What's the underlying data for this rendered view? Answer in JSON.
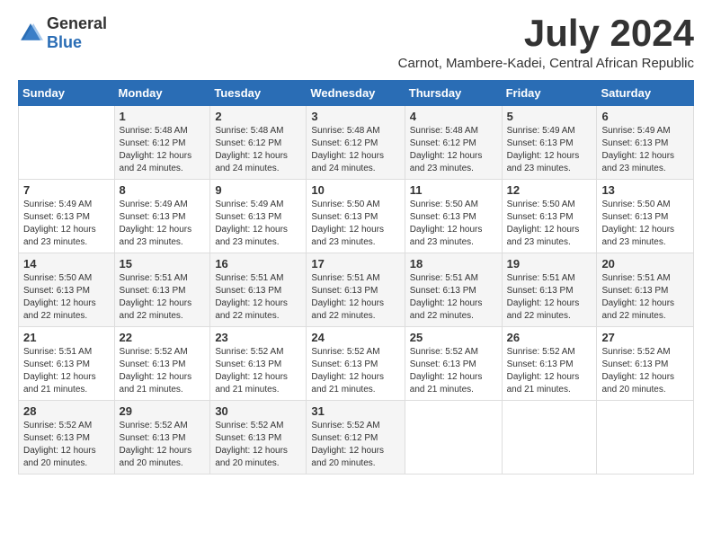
{
  "logo": {
    "general": "General",
    "blue": "Blue"
  },
  "title": "July 2024",
  "subtitle": "Carnot, Mambere-Kadei, Central African Republic",
  "days_header": [
    "Sunday",
    "Monday",
    "Tuesday",
    "Wednesday",
    "Thursday",
    "Friday",
    "Saturday"
  ],
  "weeks": [
    [
      {
        "num": "",
        "sunrise": "",
        "sunset": "",
        "daylight": ""
      },
      {
        "num": "1",
        "sunrise": "Sunrise: 5:48 AM",
        "sunset": "Sunset: 6:12 PM",
        "daylight": "Daylight: 12 hours and 24 minutes."
      },
      {
        "num": "2",
        "sunrise": "Sunrise: 5:48 AM",
        "sunset": "Sunset: 6:12 PM",
        "daylight": "Daylight: 12 hours and 24 minutes."
      },
      {
        "num": "3",
        "sunrise": "Sunrise: 5:48 AM",
        "sunset": "Sunset: 6:12 PM",
        "daylight": "Daylight: 12 hours and 24 minutes."
      },
      {
        "num": "4",
        "sunrise": "Sunrise: 5:48 AM",
        "sunset": "Sunset: 6:12 PM",
        "daylight": "Daylight: 12 hours and 23 minutes."
      },
      {
        "num": "5",
        "sunrise": "Sunrise: 5:49 AM",
        "sunset": "Sunset: 6:13 PM",
        "daylight": "Daylight: 12 hours and 23 minutes."
      },
      {
        "num": "6",
        "sunrise": "Sunrise: 5:49 AM",
        "sunset": "Sunset: 6:13 PM",
        "daylight": "Daylight: 12 hours and 23 minutes."
      }
    ],
    [
      {
        "num": "7",
        "sunrise": "Sunrise: 5:49 AM",
        "sunset": "Sunset: 6:13 PM",
        "daylight": "Daylight: 12 hours and 23 minutes."
      },
      {
        "num": "8",
        "sunrise": "Sunrise: 5:49 AM",
        "sunset": "Sunset: 6:13 PM",
        "daylight": "Daylight: 12 hours and 23 minutes."
      },
      {
        "num": "9",
        "sunrise": "Sunrise: 5:49 AM",
        "sunset": "Sunset: 6:13 PM",
        "daylight": "Daylight: 12 hours and 23 minutes."
      },
      {
        "num": "10",
        "sunrise": "Sunrise: 5:50 AM",
        "sunset": "Sunset: 6:13 PM",
        "daylight": "Daylight: 12 hours and 23 minutes."
      },
      {
        "num": "11",
        "sunrise": "Sunrise: 5:50 AM",
        "sunset": "Sunset: 6:13 PM",
        "daylight": "Daylight: 12 hours and 23 minutes."
      },
      {
        "num": "12",
        "sunrise": "Sunrise: 5:50 AM",
        "sunset": "Sunset: 6:13 PM",
        "daylight": "Daylight: 12 hours and 23 minutes."
      },
      {
        "num": "13",
        "sunrise": "Sunrise: 5:50 AM",
        "sunset": "Sunset: 6:13 PM",
        "daylight": "Daylight: 12 hours and 23 minutes."
      }
    ],
    [
      {
        "num": "14",
        "sunrise": "Sunrise: 5:50 AM",
        "sunset": "Sunset: 6:13 PM",
        "daylight": "Daylight: 12 hours and 22 minutes."
      },
      {
        "num": "15",
        "sunrise": "Sunrise: 5:51 AM",
        "sunset": "Sunset: 6:13 PM",
        "daylight": "Daylight: 12 hours and 22 minutes."
      },
      {
        "num": "16",
        "sunrise": "Sunrise: 5:51 AM",
        "sunset": "Sunset: 6:13 PM",
        "daylight": "Daylight: 12 hours and 22 minutes."
      },
      {
        "num": "17",
        "sunrise": "Sunrise: 5:51 AM",
        "sunset": "Sunset: 6:13 PM",
        "daylight": "Daylight: 12 hours and 22 minutes."
      },
      {
        "num": "18",
        "sunrise": "Sunrise: 5:51 AM",
        "sunset": "Sunset: 6:13 PM",
        "daylight": "Daylight: 12 hours and 22 minutes."
      },
      {
        "num": "19",
        "sunrise": "Sunrise: 5:51 AM",
        "sunset": "Sunset: 6:13 PM",
        "daylight": "Daylight: 12 hours and 22 minutes."
      },
      {
        "num": "20",
        "sunrise": "Sunrise: 5:51 AM",
        "sunset": "Sunset: 6:13 PM",
        "daylight": "Daylight: 12 hours and 22 minutes."
      }
    ],
    [
      {
        "num": "21",
        "sunrise": "Sunrise: 5:51 AM",
        "sunset": "Sunset: 6:13 PM",
        "daylight": "Daylight: 12 hours and 21 minutes."
      },
      {
        "num": "22",
        "sunrise": "Sunrise: 5:52 AM",
        "sunset": "Sunset: 6:13 PM",
        "daylight": "Daylight: 12 hours and 21 minutes."
      },
      {
        "num": "23",
        "sunrise": "Sunrise: 5:52 AM",
        "sunset": "Sunset: 6:13 PM",
        "daylight": "Daylight: 12 hours and 21 minutes."
      },
      {
        "num": "24",
        "sunrise": "Sunrise: 5:52 AM",
        "sunset": "Sunset: 6:13 PM",
        "daylight": "Daylight: 12 hours and 21 minutes."
      },
      {
        "num": "25",
        "sunrise": "Sunrise: 5:52 AM",
        "sunset": "Sunset: 6:13 PM",
        "daylight": "Daylight: 12 hours and 21 minutes."
      },
      {
        "num": "26",
        "sunrise": "Sunrise: 5:52 AM",
        "sunset": "Sunset: 6:13 PM",
        "daylight": "Daylight: 12 hours and 21 minutes."
      },
      {
        "num": "27",
        "sunrise": "Sunrise: 5:52 AM",
        "sunset": "Sunset: 6:13 PM",
        "daylight": "Daylight: 12 hours and 20 minutes."
      }
    ],
    [
      {
        "num": "28",
        "sunrise": "Sunrise: 5:52 AM",
        "sunset": "Sunset: 6:13 PM",
        "daylight": "Daylight: 12 hours and 20 minutes."
      },
      {
        "num": "29",
        "sunrise": "Sunrise: 5:52 AM",
        "sunset": "Sunset: 6:13 PM",
        "daylight": "Daylight: 12 hours and 20 minutes."
      },
      {
        "num": "30",
        "sunrise": "Sunrise: 5:52 AM",
        "sunset": "Sunset: 6:13 PM",
        "daylight": "Daylight: 12 hours and 20 minutes."
      },
      {
        "num": "31",
        "sunrise": "Sunrise: 5:52 AM",
        "sunset": "Sunset: 6:12 PM",
        "daylight": "Daylight: 12 hours and 20 minutes."
      },
      {
        "num": "",
        "sunrise": "",
        "sunset": "",
        "daylight": ""
      },
      {
        "num": "",
        "sunrise": "",
        "sunset": "",
        "daylight": ""
      },
      {
        "num": "",
        "sunrise": "",
        "sunset": "",
        "daylight": ""
      }
    ]
  ]
}
